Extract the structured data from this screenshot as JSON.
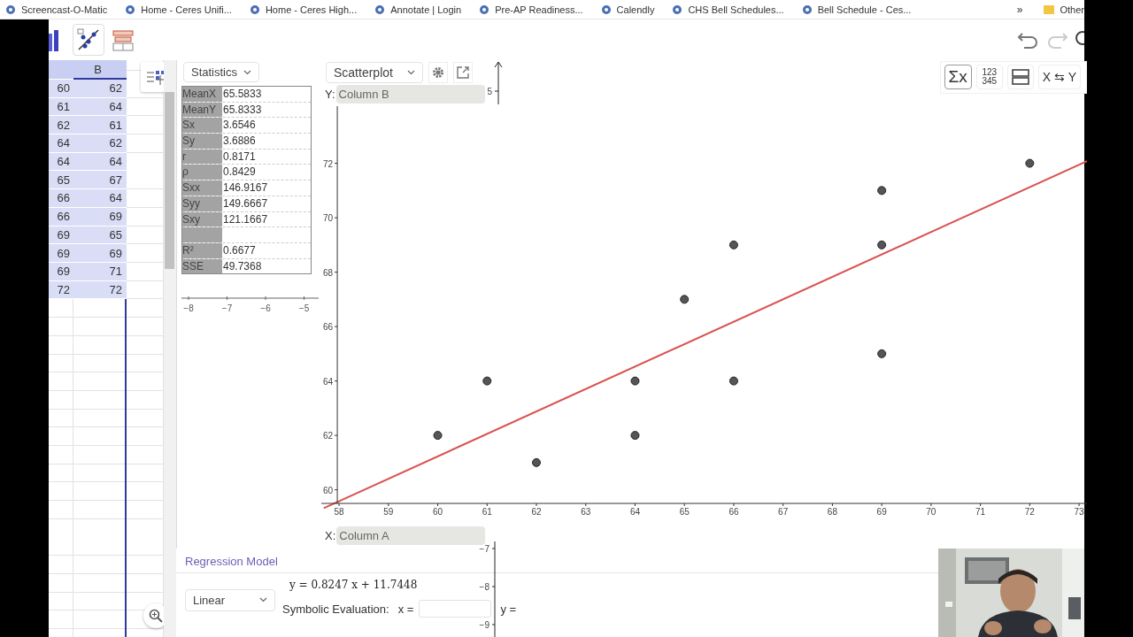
{
  "bookmarks": [
    {
      "label": "Screencast-O-Matic"
    },
    {
      "label": "Home - Ceres Unifi..."
    },
    {
      "label": "Home - Ceres High..."
    },
    {
      "label": "Annotate | Login"
    },
    {
      "label": "Pre-AP Readiness..."
    },
    {
      "label": "Calendly"
    },
    {
      "label": "CHS Bell Schedules..."
    },
    {
      "label": "Bell Schedule - Ces..."
    }
  ],
  "more_bookmarks": "»",
  "other_bookmarks": "Other",
  "spreadsheet": {
    "columns": [
      "B"
    ],
    "rows": [
      {
        "a": "60",
        "b": "62",
        "selected": true
      },
      {
        "a": "61",
        "b": "64",
        "selected": true
      },
      {
        "a": "62",
        "b": "61",
        "selected": true
      },
      {
        "a": "64",
        "b": "62",
        "selected": true
      },
      {
        "a": "64",
        "b": "64",
        "selected": true
      },
      {
        "a": "65",
        "b": "67",
        "selected": true
      },
      {
        "a": "66",
        "b": "64",
        "selected": true
      },
      {
        "a": "66",
        "b": "69",
        "selected": true
      },
      {
        "a": "69",
        "b": "65",
        "selected": true
      },
      {
        "a": "69",
        "b": "69",
        "selected": true
      },
      {
        "a": "69",
        "b": "71",
        "selected": true
      },
      {
        "a": "72",
        "b": "72",
        "selected": true
      }
    ]
  },
  "statistics": {
    "mode": "Statistics",
    "rows": [
      {
        "kind": "stat",
        "label": "MeanX",
        "value": "65.5833"
      },
      {
        "kind": "stat",
        "label": "MeanY",
        "value": "65.8333"
      },
      {
        "kind": "stat",
        "label": "Sx",
        "value": "3.6546"
      },
      {
        "kind": "stat",
        "label": "Sy",
        "value": "3.6886"
      },
      {
        "kind": "stat",
        "label": "r",
        "value": "0.8171"
      },
      {
        "kind": "stat",
        "label": "ρ",
        "value": "0.8429"
      },
      {
        "kind": "stat",
        "label": "Sxx",
        "value": "146.9167"
      },
      {
        "kind": "stat",
        "label": "Syy",
        "value": "149.6667"
      },
      {
        "kind": "stat",
        "label": "Sxy",
        "value": "121.1667"
      },
      {
        "kind": "gap"
      },
      {
        "kind": "stat",
        "label": "R²",
        "value": "0.6677"
      },
      {
        "kind": "stat",
        "label": "SSE",
        "value": "49.7368"
      }
    ],
    "axis_ticks": [
      "−8",
      "−7",
      "−6",
      "−5"
    ]
  },
  "plot": {
    "type_menu": "Scatterplot",
    "y_label": "Y:",
    "y_source": "Column B",
    "x_label": "X:",
    "x_source": "Column A",
    "background_tick": "5",
    "chart_data": {
      "type": "scatter",
      "x": [
        60,
        61,
        62,
        64,
        64,
        65,
        66,
        66,
        69,
        69,
        69,
        72
      ],
      "xlim": [
        57.64,
        73.16
      ],
      "ylim": [
        59.5,
        74.1
      ],
      "xticks": [
        58,
        59,
        60,
        61,
        62,
        63,
        64,
        65,
        66,
        67,
        68,
        69,
        70,
        71,
        72,
        73
      ],
      "yticks": [
        60,
        62,
        64,
        66,
        68,
        70,
        72
      ],
      "series": [
        {
          "color": "#555555",
          "values": [
            62,
            64,
            61,
            62,
            64,
            67,
            64,
            69,
            65,
            69,
            71,
            72
          ]
        }
      ]
    },
    "fit_line": {
      "color": "#d9534f"
    }
  },
  "view_buttons": [
    {
      "kind": "sum",
      "label": "Σx",
      "selected": true
    },
    {
      "kind": "numbers",
      "lines": [
        "123",
        "345"
      ],
      "selected": false
    },
    {
      "kind": "layout",
      "selected": false
    },
    {
      "kind": "swap",
      "label": "X ⇆ Y",
      "selected": false
    }
  ],
  "regression": {
    "title": "Regression Model",
    "model": "Linear",
    "equation": "y = 0.8247 x + 11.7448",
    "symbolic_label": "Symbolic Evaluation:",
    "x_label": "x =",
    "y_label": "y ="
  },
  "background_ticks": [
    "−7",
    "−8",
    "−9"
  ]
}
